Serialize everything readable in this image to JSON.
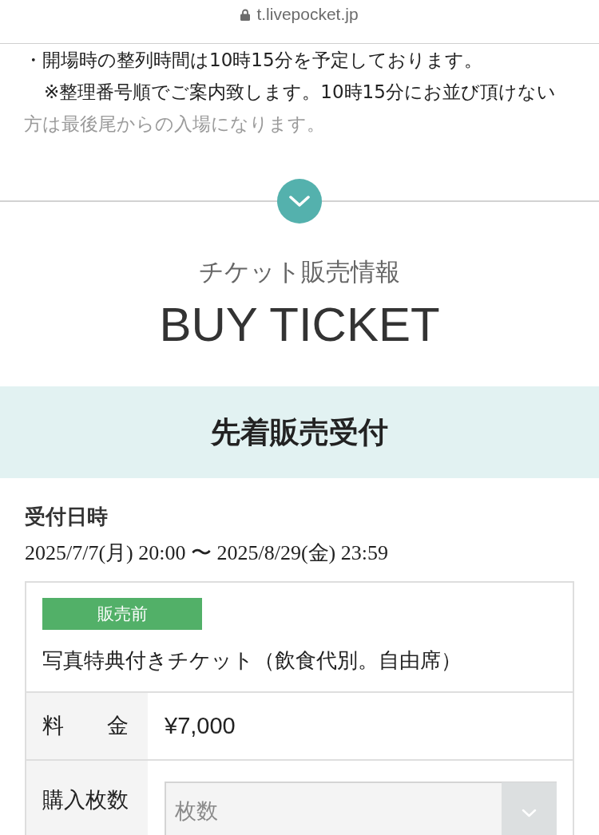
{
  "address_bar": {
    "url": "t.livepocket.jp"
  },
  "notice_lines": [
    {
      "text": "・開場時の整列時間は10時15分を予定しております。",
      "indent": false,
      "faded": false
    },
    {
      "text": "※整理番号順でご案内致します。10時15分にお並び頂けない",
      "indent": true,
      "faded": false
    },
    {
      "text": "方は最後尾からの入場になります。",
      "indent": false,
      "faded": true
    }
  ],
  "section": {
    "subtitle": "チケット販売情報",
    "title": "BUY TICKET"
  },
  "sale_banner": {
    "title": "先着販売受付"
  },
  "reception": {
    "label": "受付日時",
    "period": "2025/7/7(月) 20:00 〜 2025/8/29(金) 23:59"
  },
  "tickets": [
    {
      "status": "販売前",
      "name": "写真特典付きチケット（飲食代別。自由席）",
      "rows": [
        {
          "kind": "text",
          "label": "料　　金",
          "value": "¥7,000"
        },
        {
          "kind": "select",
          "label": "購入枚数",
          "placeholder": "枚数"
        }
      ]
    }
  ]
}
